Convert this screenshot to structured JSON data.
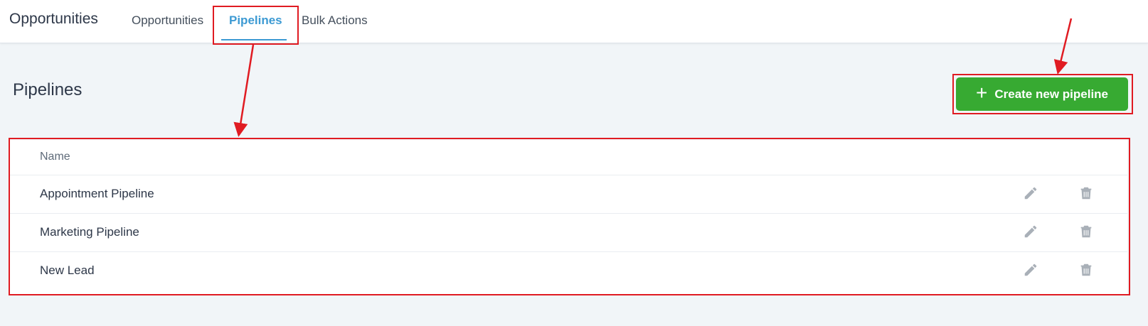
{
  "header": {
    "app_title": "Opportunities",
    "tabs": [
      {
        "label": "Opportunities",
        "active": false
      },
      {
        "label": "Pipelines",
        "active": true
      },
      {
        "label": "Bulk Actions",
        "active": false
      }
    ]
  },
  "main": {
    "heading": "Pipelines",
    "create_button_label": "Create new pipeline",
    "table": {
      "column_name": "Name",
      "rows": [
        {
          "name": "Appointment Pipeline"
        },
        {
          "name": "Marketing Pipeline"
        },
        {
          "name": "New Lead"
        }
      ]
    }
  },
  "colors": {
    "accent": "#3d9ad3",
    "create_button": "#37aa32",
    "annotation": "#e01b22",
    "background": "#f1f5f8"
  },
  "icons": [
    "plus-icon",
    "pencil-icon",
    "trash-icon",
    "arrow-annotation"
  ]
}
